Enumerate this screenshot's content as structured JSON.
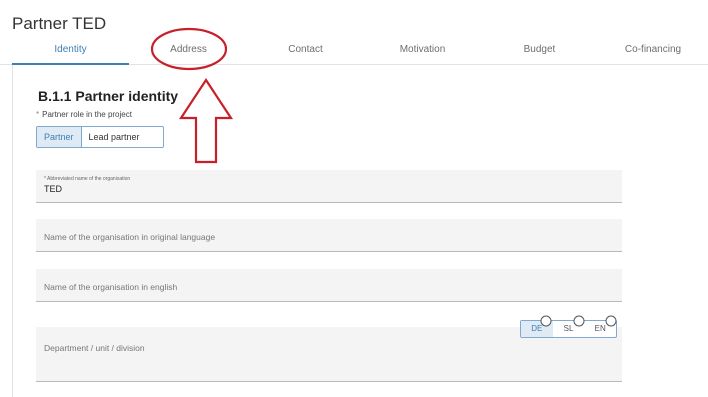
{
  "page": {
    "title": "Partner TED"
  },
  "tabs": [
    {
      "label": "Identity",
      "active": true
    },
    {
      "label": "Address",
      "active": false
    },
    {
      "label": "Contact",
      "active": false
    },
    {
      "label": "Motivation",
      "active": false
    },
    {
      "label": "Budget",
      "active": false
    },
    {
      "label": "Co-financing",
      "active": false
    }
  ],
  "section": {
    "heading": "B.1.1 Partner identity",
    "role_label": "Partner role in the project",
    "required_mark": "*",
    "role_options": [
      "Partner",
      "Lead partner"
    ],
    "role_selected": "Partner"
  },
  "fields": {
    "abbreviated_name": {
      "label": "* Abbreviated name of the organisation",
      "value": "TED"
    },
    "original_name": {
      "placeholder": "Name of the organisation in original language"
    },
    "english_name": {
      "placeholder": "Name of the organisation in english"
    },
    "department": {
      "placeholder": "Department / unit / division"
    }
  },
  "languages": {
    "options": [
      "DE",
      "SL",
      "EN"
    ],
    "selected": "DE"
  },
  "colors": {
    "accent": "#3e7fb6",
    "annotation": "#c8202a",
    "field_bg": "#f4f4f4"
  }
}
